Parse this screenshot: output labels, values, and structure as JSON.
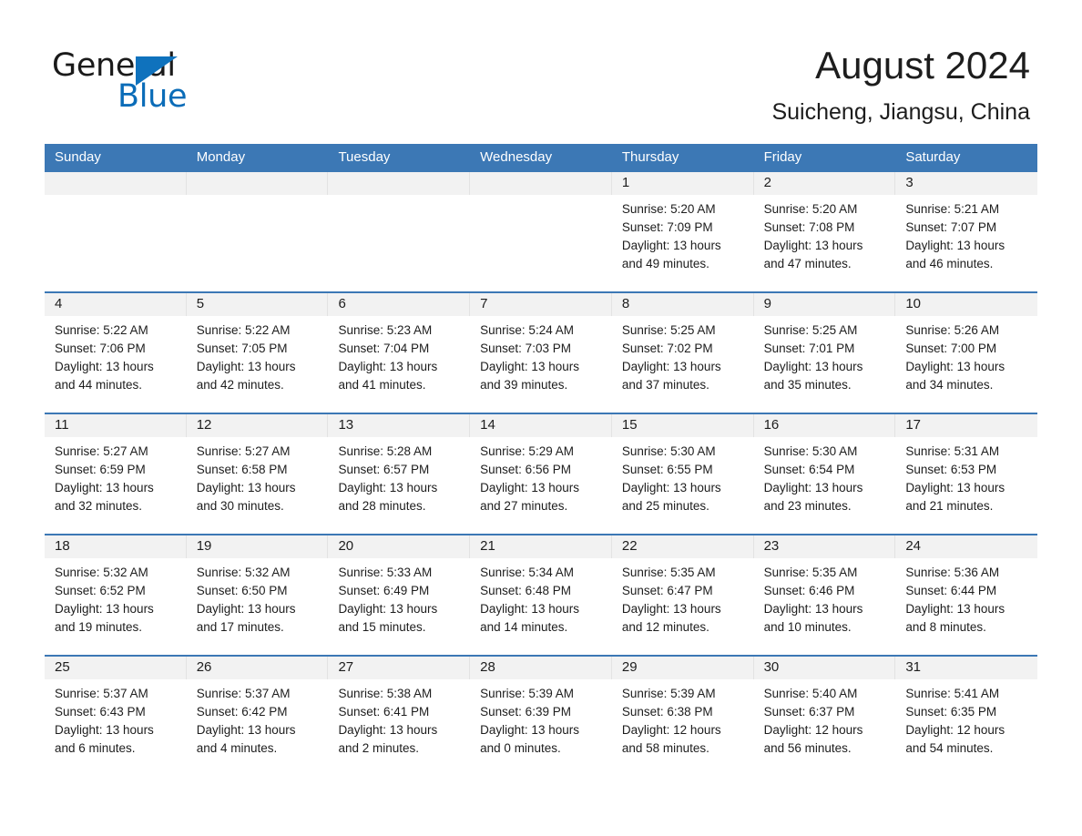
{
  "brand": {
    "word_one": "General",
    "word_two": "Blue",
    "triangle_color": "#0f72bd",
    "blue_text_color": "#0a6cb8"
  },
  "header": {
    "month_title": "August 2024",
    "location": "Suicheng, Jiangsu, China"
  },
  "calendar": {
    "header_bg": "#3c78b5",
    "day_band_bg": "#f2f2f2",
    "weekdays": [
      "Sunday",
      "Monday",
      "Tuesday",
      "Wednesday",
      "Thursday",
      "Friday",
      "Saturday"
    ],
    "weeks": [
      [
        {
          "day": "",
          "lines": []
        },
        {
          "day": "",
          "lines": []
        },
        {
          "day": "",
          "lines": []
        },
        {
          "day": "",
          "lines": []
        },
        {
          "day": "1",
          "lines": [
            "Sunrise: 5:20 AM",
            "Sunset: 7:09 PM",
            "Daylight: 13 hours",
            "and 49 minutes."
          ]
        },
        {
          "day": "2",
          "lines": [
            "Sunrise: 5:20 AM",
            "Sunset: 7:08 PM",
            "Daylight: 13 hours",
            "and 47 minutes."
          ]
        },
        {
          "day": "3",
          "lines": [
            "Sunrise: 5:21 AM",
            "Sunset: 7:07 PM",
            "Daylight: 13 hours",
            "and 46 minutes."
          ]
        }
      ],
      [
        {
          "day": "4",
          "lines": [
            "Sunrise: 5:22 AM",
            "Sunset: 7:06 PM",
            "Daylight: 13 hours",
            "and 44 minutes."
          ]
        },
        {
          "day": "5",
          "lines": [
            "Sunrise: 5:22 AM",
            "Sunset: 7:05 PM",
            "Daylight: 13 hours",
            "and 42 minutes."
          ]
        },
        {
          "day": "6",
          "lines": [
            "Sunrise: 5:23 AM",
            "Sunset: 7:04 PM",
            "Daylight: 13 hours",
            "and 41 minutes."
          ]
        },
        {
          "day": "7",
          "lines": [
            "Sunrise: 5:24 AM",
            "Sunset: 7:03 PM",
            "Daylight: 13 hours",
            "and 39 minutes."
          ]
        },
        {
          "day": "8",
          "lines": [
            "Sunrise: 5:25 AM",
            "Sunset: 7:02 PM",
            "Daylight: 13 hours",
            "and 37 minutes."
          ]
        },
        {
          "day": "9",
          "lines": [
            "Sunrise: 5:25 AM",
            "Sunset: 7:01 PM",
            "Daylight: 13 hours",
            "and 35 minutes."
          ]
        },
        {
          "day": "10",
          "lines": [
            "Sunrise: 5:26 AM",
            "Sunset: 7:00 PM",
            "Daylight: 13 hours",
            "and 34 minutes."
          ]
        }
      ],
      [
        {
          "day": "11",
          "lines": [
            "Sunrise: 5:27 AM",
            "Sunset: 6:59 PM",
            "Daylight: 13 hours",
            "and 32 minutes."
          ]
        },
        {
          "day": "12",
          "lines": [
            "Sunrise: 5:27 AM",
            "Sunset: 6:58 PM",
            "Daylight: 13 hours",
            "and 30 minutes."
          ]
        },
        {
          "day": "13",
          "lines": [
            "Sunrise: 5:28 AM",
            "Sunset: 6:57 PM",
            "Daylight: 13 hours",
            "and 28 minutes."
          ]
        },
        {
          "day": "14",
          "lines": [
            "Sunrise: 5:29 AM",
            "Sunset: 6:56 PM",
            "Daylight: 13 hours",
            "and 27 minutes."
          ]
        },
        {
          "day": "15",
          "lines": [
            "Sunrise: 5:30 AM",
            "Sunset: 6:55 PM",
            "Daylight: 13 hours",
            "and 25 minutes."
          ]
        },
        {
          "day": "16",
          "lines": [
            "Sunrise: 5:30 AM",
            "Sunset: 6:54 PM",
            "Daylight: 13 hours",
            "and 23 minutes."
          ]
        },
        {
          "day": "17",
          "lines": [
            "Sunrise: 5:31 AM",
            "Sunset: 6:53 PM",
            "Daylight: 13 hours",
            "and 21 minutes."
          ]
        }
      ],
      [
        {
          "day": "18",
          "lines": [
            "Sunrise: 5:32 AM",
            "Sunset: 6:52 PM",
            "Daylight: 13 hours",
            "and 19 minutes."
          ]
        },
        {
          "day": "19",
          "lines": [
            "Sunrise: 5:32 AM",
            "Sunset: 6:50 PM",
            "Daylight: 13 hours",
            "and 17 minutes."
          ]
        },
        {
          "day": "20",
          "lines": [
            "Sunrise: 5:33 AM",
            "Sunset: 6:49 PM",
            "Daylight: 13 hours",
            "and 15 minutes."
          ]
        },
        {
          "day": "21",
          "lines": [
            "Sunrise: 5:34 AM",
            "Sunset: 6:48 PM",
            "Daylight: 13 hours",
            "and 14 minutes."
          ]
        },
        {
          "day": "22",
          "lines": [
            "Sunrise: 5:35 AM",
            "Sunset: 6:47 PM",
            "Daylight: 13 hours",
            "and 12 minutes."
          ]
        },
        {
          "day": "23",
          "lines": [
            "Sunrise: 5:35 AM",
            "Sunset: 6:46 PM",
            "Daylight: 13 hours",
            "and 10 minutes."
          ]
        },
        {
          "day": "24",
          "lines": [
            "Sunrise: 5:36 AM",
            "Sunset: 6:44 PM",
            "Daylight: 13 hours",
            "and 8 minutes."
          ]
        }
      ],
      [
        {
          "day": "25",
          "lines": [
            "Sunrise: 5:37 AM",
            "Sunset: 6:43 PM",
            "Daylight: 13 hours",
            "and 6 minutes."
          ]
        },
        {
          "day": "26",
          "lines": [
            "Sunrise: 5:37 AM",
            "Sunset: 6:42 PM",
            "Daylight: 13 hours",
            "and 4 minutes."
          ]
        },
        {
          "day": "27",
          "lines": [
            "Sunrise: 5:38 AM",
            "Sunset: 6:41 PM",
            "Daylight: 13 hours",
            "and 2 minutes."
          ]
        },
        {
          "day": "28",
          "lines": [
            "Sunrise: 5:39 AM",
            "Sunset: 6:39 PM",
            "Daylight: 13 hours",
            "and 0 minutes."
          ]
        },
        {
          "day": "29",
          "lines": [
            "Sunrise: 5:39 AM",
            "Sunset: 6:38 PM",
            "Daylight: 12 hours",
            "and 58 minutes."
          ]
        },
        {
          "day": "30",
          "lines": [
            "Sunrise: 5:40 AM",
            "Sunset: 6:37 PM",
            "Daylight: 12 hours",
            "and 56 minutes."
          ]
        },
        {
          "day": "31",
          "lines": [
            "Sunrise: 5:41 AM",
            "Sunset: 6:35 PM",
            "Daylight: 12 hours",
            "and 54 minutes."
          ]
        }
      ]
    ]
  }
}
